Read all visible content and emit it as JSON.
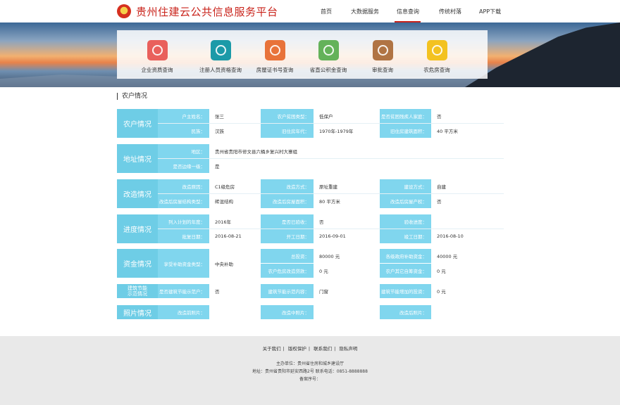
{
  "header": {
    "site_title": "贵州住建云公共信息服务平台",
    "nav": [
      "首页",
      "大数据服务",
      "信息查询",
      "传统村落",
      "APP下载"
    ],
    "active_nav": "信息查询"
  },
  "menu": [
    {
      "label": "企业资质查询",
      "color": "#e9605c"
    },
    {
      "label": "注册人员资格查询",
      "color": "#1b9aa8"
    },
    {
      "label": "房屋证书号查询",
      "color": "#e8733a"
    },
    {
      "label": "省直公积金查询",
      "color": "#64b25a"
    },
    {
      "label": "审批查询",
      "color": "#b07444"
    },
    {
      "label": "农危房查询",
      "color": "#f3c220"
    }
  ],
  "section_title": "农户情况",
  "groups": {
    "farmer": {
      "label": "农户情况",
      "r1": [
        "户主姓名：",
        "张三",
        "农户贫困类型：",
        "低保户",
        "是否贫困残疾人家庭：",
        "否"
      ],
      "r2": [
        "民族：",
        "汉族",
        "旧住房年代：",
        "1970年-1979年",
        "旧住房建筑面积：",
        "40 平方米"
      ]
    },
    "address": {
      "label": "地址情况",
      "r1": [
        "地区：",
        "贵州省贵阳市修文县六桶乡复兴村大寨组"
      ],
      "r2": [
        "是否边缘一级：",
        "是"
      ]
    },
    "rebuild": {
      "label": "改造情况",
      "r1": [
        "改造原因：",
        "C1级危房",
        "改造方式：",
        "原址重建",
        "建设方式：",
        "自建"
      ],
      "r2": [
        "改造后房屋结构类型：",
        "砖混结构",
        "改造后房屋面积：",
        "80 平方米",
        "改造后房屋产权：",
        "否"
      ]
    },
    "progress": {
      "label": "进度情况",
      "r1": [
        "列入计划的年度：",
        "2016年",
        "是否已验收：",
        "否",
        "验收进度：",
        ""
      ],
      "r2": [
        "批复日期：",
        "2016-08-21",
        "开工日期：",
        "2016-09-01",
        "竣工日期：",
        "2016-08-10"
      ]
    },
    "funds": {
      "label": "资金情况",
      "left": [
        "享受补助资金类型：",
        "中央补助"
      ],
      "r1": [
        "总投资：",
        "80000 元",
        "各级政府补助资金：",
        "40000 元"
      ],
      "r2": [
        "农户危房改造贷款：",
        "0 元",
        "农户其它自筹资金：",
        "0 元"
      ]
    },
    "energy": {
      "label": "建筑节能\n示范情况",
      "r1": [
        "是否建筑节能示范户：",
        "否",
        "建筑节能示范内容：",
        "门窗",
        "建筑节能增加的投资：",
        "0 元"
      ]
    },
    "photo": {
      "label": "照片情况",
      "r1": [
        "改造前照片：",
        "",
        "改造中照片：",
        "",
        "改造后照片：",
        ""
      ]
    }
  },
  "footer": {
    "links": [
      "关于我们",
      "版权保护",
      "联系我们",
      "隐私声明"
    ],
    "sponsor": "主办单位：贵州省住房和城乡建设厅",
    "address": "地址：贵州省贵阳市延安西路2号  联系电话：0851-8888888",
    "icp": "备案序号："
  }
}
